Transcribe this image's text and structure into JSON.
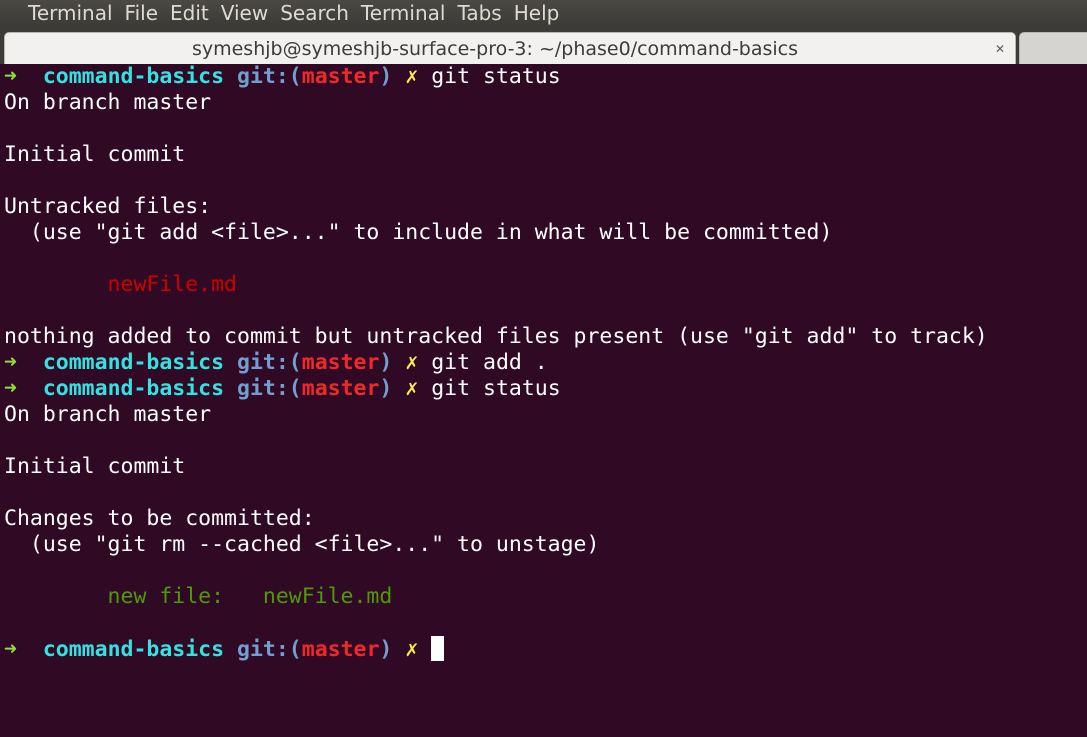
{
  "menubar": {
    "items": [
      "Terminal",
      "File",
      "Edit",
      "View",
      "Search",
      "Terminal",
      "Tabs",
      "Help"
    ]
  },
  "window": {
    "title": "symeshjb@symeshjb-surface-pro-3: ~/phase0/command-basics",
    "close_glyph": "✕"
  },
  "prompt": {
    "arrow": "➜",
    "dir": "command-basics",
    "git_label": "git:(",
    "branch": "master",
    "close_paren": ")",
    "dirty": "✗"
  },
  "terminal": {
    "cmd1": "git status",
    "status1": {
      "branch_line": "On branch master",
      "commit_line": "Initial commit",
      "header": "Untracked files:",
      "hint": "  (use \"git add <file>...\" to include in what will be committed)",
      "file": "        newFile.md",
      "summary": "nothing added to commit but untracked files present (use \"git add\" to track)"
    },
    "cmd2": "git add .",
    "cmd3": "git status",
    "status2": {
      "branch_line": "On branch master",
      "commit_line": "Initial commit",
      "header": "Changes to be committed:",
      "hint": "  (use \"git rm --cached <file>...\" to unstage)",
      "file": "        new file:   newFile.md"
    }
  },
  "colors": {
    "background": "#300a24",
    "prompt_arrow": "#8ae234",
    "prompt_dir": "#34e2e2",
    "prompt_git": "#729fcf",
    "prompt_branch": "#ef2929",
    "prompt_dirty": "#fce94f",
    "untracked_file": "#cc0000",
    "staged_file": "#4e9a06"
  }
}
